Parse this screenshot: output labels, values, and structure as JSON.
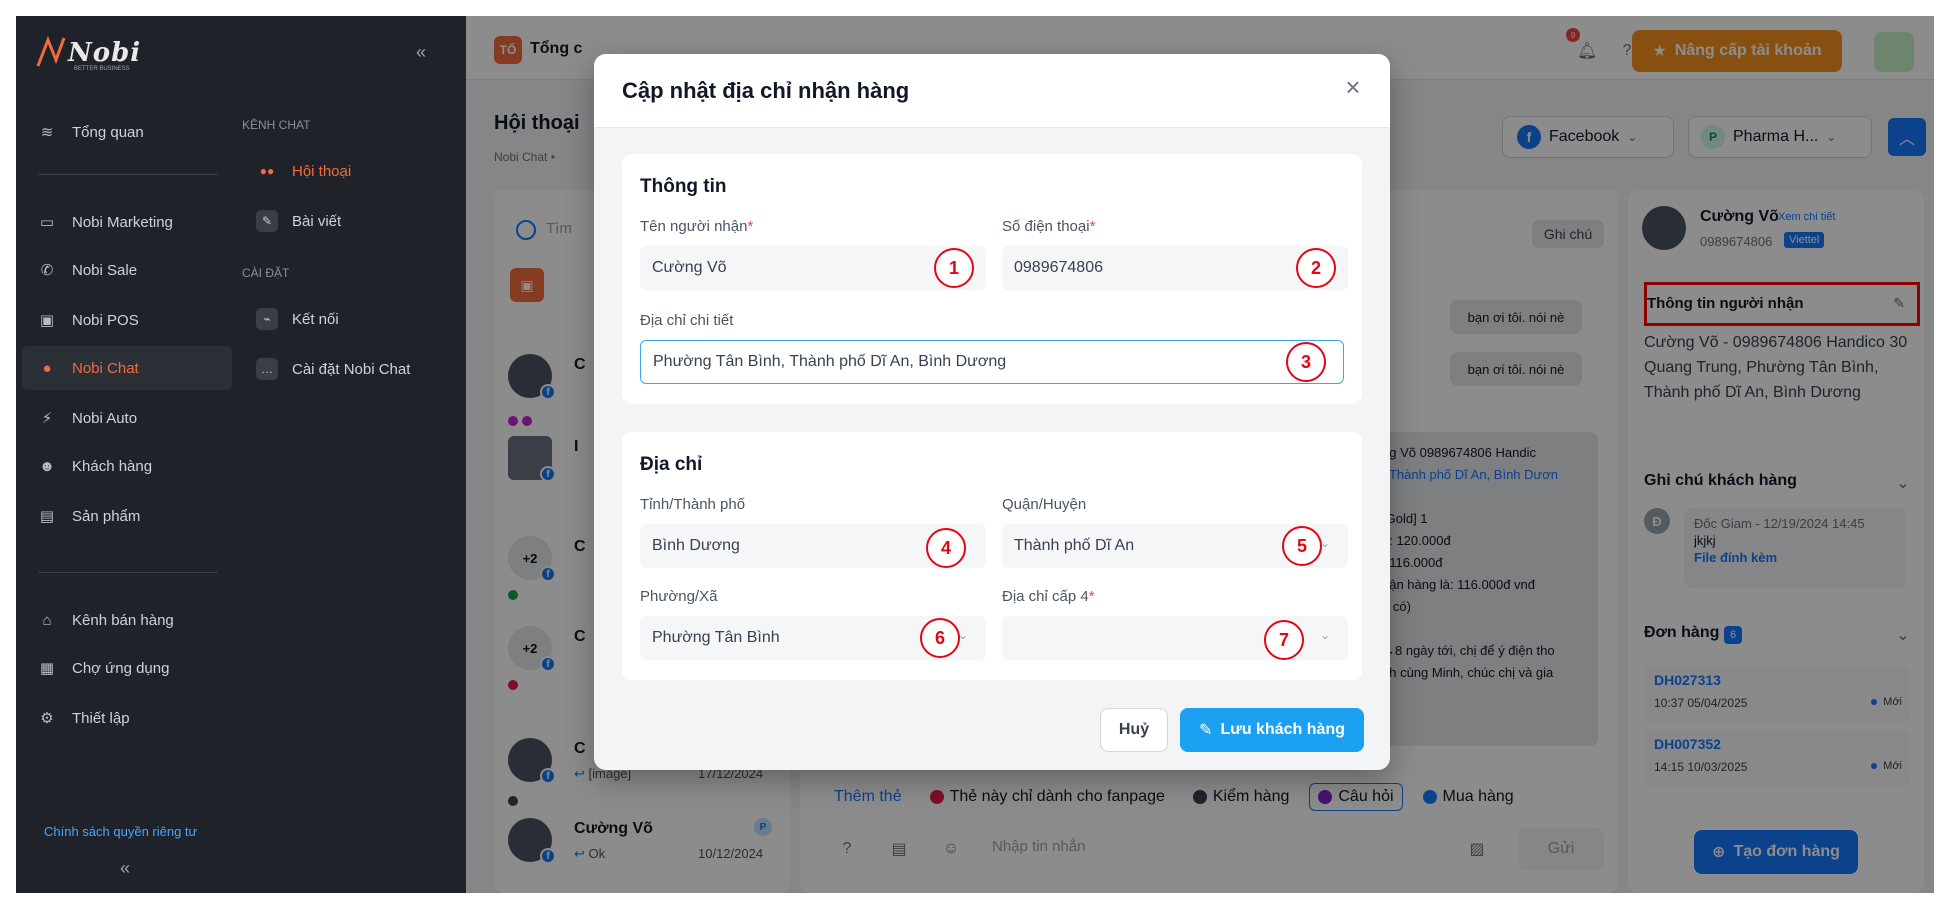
{
  "sidebar": {
    "logo_text": "Nobi",
    "logo_sub": "BETTER BUSINESS",
    "main_items": [
      {
        "label": "Tổng quan",
        "icon": "layers-icon"
      },
      {
        "label": "Nobi Marketing",
        "icon": "inbox-icon"
      },
      {
        "label": "Nobi Sale",
        "icon": "phone-icon"
      },
      {
        "label": "Nobi POS",
        "icon": "pos-icon"
      },
      {
        "label": "Nobi Chat",
        "icon": "chat-icon"
      },
      {
        "label": "Nobi Auto",
        "icon": "auto-icon"
      },
      {
        "label": "Khách hàng",
        "icon": "users-icon"
      },
      {
        "label": "Sản phẩm",
        "icon": "file-icon"
      },
      {
        "label": "Kênh bán hàng",
        "icon": "store-icon"
      },
      {
        "label": "Chợ ứng dụng",
        "icon": "apps-icon"
      },
      {
        "label": "Thiết lập",
        "icon": "gear-icon"
      }
    ],
    "privacy": "Chính sách quyền riêng tư",
    "sub": {
      "section_chat": "KÊNH CHAT",
      "chat_items": [
        {
          "label": "Hội thoại"
        },
        {
          "label": "Bài viết"
        }
      ],
      "section_settings": "CÀI ĐẶT",
      "settings_items": [
        {
          "label": "Kết nối"
        },
        {
          "label": "Cài đặt Nobi Chat"
        }
      ]
    }
  },
  "topbar": {
    "shop_badge": "TỐ",
    "shop_name": "Tổng c",
    "notif_count": "9",
    "upgrade_label": "Nâng cấp tài khoản"
  },
  "page": {
    "title": "Hội thoại",
    "breadcrumb": "Nobi Chat  •",
    "channel": "Facebook",
    "page_name": "Pharma H..."
  },
  "conversations": {
    "search_placeholder": "Tìm",
    "rows": [
      {
        "name": "C",
        "msg": "",
        "date": "",
        "dots": [
          "#c026d3",
          "#c026d3"
        ]
      },
      {
        "name": "I",
        "msg": "",
        "date": "",
        "dots": []
      },
      {
        "name": "C",
        "msg": "",
        "date": "",
        "dots": [
          "#16a34a"
        ],
        "extra": "+2"
      },
      {
        "name": "C",
        "msg": "",
        "date": "",
        "dots": [
          "#e11d48"
        ],
        "extra": "+2"
      },
      {
        "name": "C",
        "msg": "[image]",
        "date": "17/12/2024",
        "dots": [
          "#374151"
        ]
      },
      {
        "name": "Cường Võ",
        "msg": "Ok",
        "date": "10/12/2024",
        "dots": []
      }
    ]
  },
  "chat": {
    "ghi_chu": "Ghi chú",
    "bubble1": "bạn ơi tôi. nói nè",
    "bubble2": "bạn ơi tôi. nói nè",
    "big_lines": [
      "ng Võ 0989674806 Handic",
      ", Thành phố Dĩ An, Bình Dươn",
      "",
      ":Gold] 1",
      "ế: 120.000đ",
      ": 116.000đ",
      "nận hàng là: 116.000đ vnđ",
      "u có)",
      "",
      "→8 ngày tới, chị để ý điện tho",
      "nh cùng Minh, chúc chị và gia"
    ],
    "tags": [
      {
        "label": "Thêm thẻ",
        "color": ""
      },
      {
        "label": "Thẻ này chỉ dành cho fanpage",
        "color": "#e11d48"
      },
      {
        "label": "Kiểm hàng",
        "color": "#374151"
      },
      {
        "label": "Câu hỏi",
        "color": "#7e22ce"
      },
      {
        "label": "Mua hàng",
        "color": "#1677ff"
      }
    ],
    "input_placeholder": "Nhập tin nhắn",
    "send_label": "Gửi"
  },
  "customer": {
    "name": "Cường Võ",
    "detail_link": "Xem chi tiết",
    "phone": "0989674806",
    "carrier": "Viettel",
    "recv_title": "Thông tin người nhận",
    "recv_address": "Cường Võ - 0989674806 Handico 30 Quang Trung, Phường Tân Bình, Thành phố Dĩ An, Bình Dương",
    "note_title": "Ghi chú khách hàng",
    "note_avatar": "Đ",
    "note_meta": "Đốc Giam - 12/19/2024 14:45",
    "note_text": "jkjkj",
    "note_file": "File đính kèm",
    "orders_title": "Đơn hàng",
    "orders_count": "6",
    "orders": [
      {
        "code": "DH027313",
        "time": "10:37 05/04/2025",
        "status": "Mới"
      },
      {
        "code": "DH007352",
        "time": "14:15 10/03/2025",
        "status": "Mới"
      }
    ],
    "create_order": "Tạo đơn hàng"
  },
  "modal": {
    "title": "Cập nhật địa chỉ nhận hàng",
    "info_section": "Thông tin",
    "name_label": "Tên người nhận",
    "name_value": "Cường Võ",
    "phone_label": "Số điện thoại",
    "phone_value": "0989674806",
    "address_label": "Địa chỉ chi tiết",
    "address_value": "Phường Tân Bình, Thành phố Dĩ An, Bình Dương",
    "addr_section": "Địa chỉ",
    "province_label": "Tỉnh/Thành phố",
    "province_value": "Bình Dương",
    "district_label": "Quận/Huyện",
    "district_value": "Thành phố Dĩ An",
    "ward_label": "Phường/Xã",
    "ward_value": "Phường Tân Bình",
    "level4_label": "Địa chỉ cấp 4",
    "level4_value": "",
    "required_mark": "*",
    "cancel_label": "Huỷ",
    "save_label": "Lưu khách hàng",
    "badges": [
      "1",
      "2",
      "3",
      "4",
      "5",
      "6",
      "7"
    ]
  },
  "colors": {
    "accent": "#1677ff",
    "brand_orange": "#f26a3e",
    "annotation_red": "#e30613"
  }
}
